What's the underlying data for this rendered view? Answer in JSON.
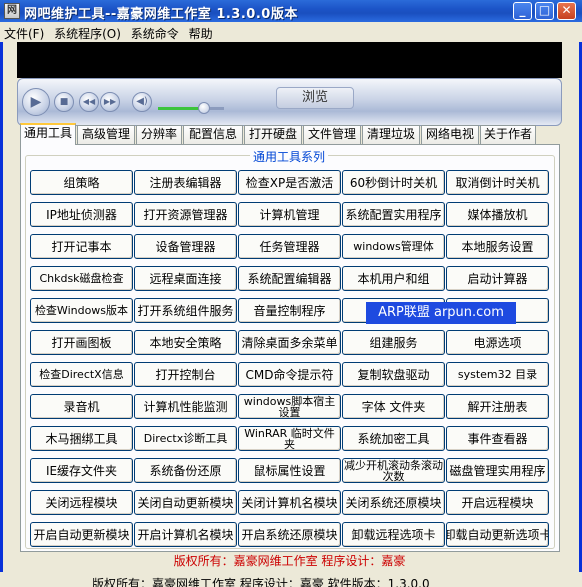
{
  "window": {
    "title": "网吧维护工具--嘉豪网维工作室 1.3.0.0版本",
    "app_icon_glyph": "网",
    "min_glyph": "_",
    "max_glyph": "□",
    "close_glyph": "✕"
  },
  "menu": [
    "文件(F)",
    "系统程序(O)",
    "系统命令",
    "帮助"
  ],
  "player": {
    "browse_label": "浏览",
    "volume_level": 0.7,
    "icons": [
      "play-icon",
      "stop-icon",
      "previous-icon",
      "next-icon",
      "volume-icon"
    ],
    "colors": {
      "screen": "#000000",
      "volume_fill": "#3cc43c"
    }
  },
  "tabs": [
    "通用工具",
    "高级管理",
    "分辨率",
    "配置信息",
    "打开硬盘",
    "文件管理",
    "清理垃圾",
    "网络电视",
    "关于作者"
  ],
  "active_tab": 0,
  "group_title": "通用工具系列",
  "buttons": [
    [
      "组策略",
      "注册表编辑器",
      "检查XP是否激活",
      "60秒倒计时关机",
      "取消倒计时关机"
    ],
    [
      "IP地址侦测器",
      "打开资源管理器",
      "计算机管理",
      "系统配置实用程序",
      "媒体播放机"
    ],
    [
      "打开记事本",
      "设备管理器",
      "任务管理器",
      "windows管理体",
      "本地服务设置"
    ],
    [
      "Chkdsk磁盘检查",
      "远程桌面连接",
      "系统配置编辑器",
      "本机用户和组",
      "启动计算器"
    ],
    [
      "检查Windows版本",
      "打开系统组件服务",
      "音量控制程序",
      "关",
      ""
    ],
    [
      "打开画图板",
      "本地安全策略",
      "清除桌面多余菜单",
      "组建服务",
      "电源选项"
    ],
    [
      "检查DirectX信息",
      "打开控制台",
      "CMD命令提示符",
      "复制软盘驱动",
      "system32 目录"
    ],
    [
      "录音机",
      "计算机性能监测",
      "windows脚本宿主设置",
      "字体 文件夹",
      "解开注册表"
    ],
    [
      "木马捆绑工具",
      "Directx诊断工具",
      "WinRAR 临时文件夹",
      "系统加密工具",
      "事件查看器"
    ],
    [
      "IE缓存文件夹",
      "系统备份还原",
      "鼠标属性设置",
      "减少开机滚动条滚动次数",
      "磁盘管理实用程序"
    ],
    [
      "关闭远程模块",
      "关闭自动更新模块",
      "关闭计算机名模块",
      "关闭系统还原模块",
      "开启远程模块"
    ],
    [
      "开启自动更新模块",
      "开启计算机名模块",
      "开启系统还原模块",
      "卸载远程选项卡",
      "卸载自动更新选项卡"
    ]
  ],
  "overlay_text": "ARP联盟 arpun.com",
  "copyright": "版权所有：嘉豪网维工作室 程序设计：嘉豪",
  "status": "版权所有：嘉豪网维工作室 程序设计：嘉豪 软件版本：1.3.0.0",
  "colors": {
    "titlebar": "#1c54c7",
    "group_title": "#0046d5",
    "copyright": "#cc0000",
    "overlay": "#1e4ae0",
    "tab_highlight": "#ffc83c"
  }
}
